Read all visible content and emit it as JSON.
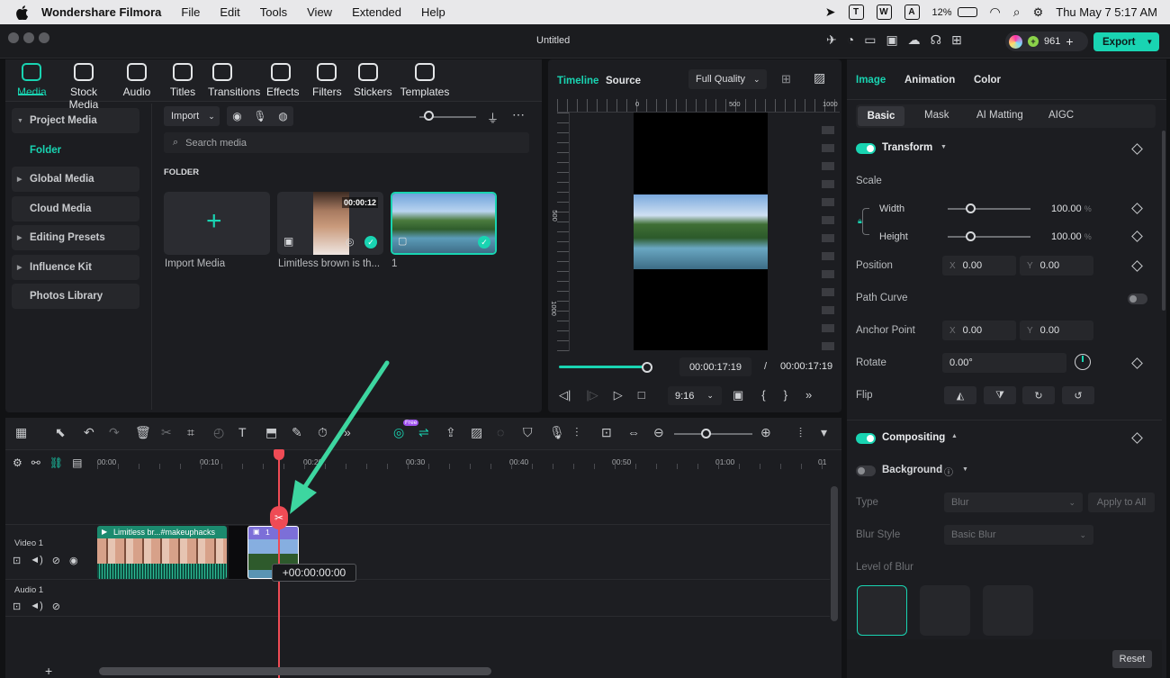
{
  "menubar": {
    "app": "Wondershare Filmora",
    "items": [
      "File",
      "Edit",
      "Tools",
      "View",
      "Extended",
      "Help"
    ],
    "battery": "12%",
    "datetime": "Thu May 7  5:17 AM"
  },
  "window": {
    "title": "Untitled",
    "credits": "961",
    "export_label": "Export"
  },
  "topnav": [
    {
      "label": "Media",
      "icon": "media-icon"
    },
    {
      "label": "Stock Media",
      "icon": "stock-media-icon"
    },
    {
      "label": "Audio",
      "icon": "audio-icon"
    },
    {
      "label": "Titles",
      "icon": "titles-icon"
    },
    {
      "label": "Transitions",
      "icon": "transitions-icon"
    },
    {
      "label": "Effects",
      "icon": "effects-icon"
    },
    {
      "label": "Filters",
      "icon": "filters-icon"
    },
    {
      "label": "Stickers",
      "icon": "stickers-icon"
    },
    {
      "label": "Templates",
      "icon": "templates-icon"
    }
  ],
  "sidebar": {
    "project_media": "Project Media",
    "folder": "Folder",
    "items": [
      "Global Media",
      "Cloud Media",
      "Editing Presets",
      "Influence Kit",
      "Photos Library"
    ]
  },
  "media": {
    "import_label": "Import",
    "search_placeholder": "Search media",
    "section": "FOLDER",
    "import_media": "Import Media",
    "clip_caption": "Limitless brown is th...",
    "clip_duration": "00:00:12",
    "image_caption": "1"
  },
  "preview": {
    "tab_timeline": "Timeline",
    "tab_source": "Source",
    "quality": "Full Quality",
    "ruler": [
      "0",
      "500",
      "1000"
    ],
    "vruler": [
      "500",
      "1000"
    ],
    "current_time": "00:00:17:19",
    "sep": "/",
    "total_time": "00:00:17:19",
    "ratio": "9:16",
    "progress": 1.0
  },
  "timeline": {
    "ticks": [
      "00:00",
      "00:10",
      "00:20",
      "00:30",
      "00:40",
      "00:50",
      "01:00",
      "01"
    ],
    "ai_badge": "Free",
    "video_track": "Video 1",
    "audio_track": "Audio 1",
    "clip1_label": "Limitless br...#makeuphacks",
    "clip2_label": "1",
    "offset_tooltip": "+00:00:00:00"
  },
  "props": {
    "tabs": [
      "Image",
      "Animation",
      "Color"
    ],
    "subtabs": [
      "Basic",
      "Mask",
      "AI Matting",
      "AIGC"
    ],
    "transform": "Transform",
    "scale": "Scale",
    "width": "Width",
    "width_val": "100.00",
    "height": "Height",
    "height_val": "100.00",
    "unit": "%",
    "position": "Position",
    "pos_x": "0.00",
    "pos_y": "0.00",
    "path_curve": "Path Curve",
    "anchor_point": "Anchor Point",
    "anchor_x": "0.00",
    "anchor_y": "0.00",
    "rotate": "Rotate",
    "rotate_val": "0.00°",
    "flip": "Flip",
    "compositing": "Compositing",
    "background": "Background",
    "type": "Type",
    "type_val": "Blur",
    "apply_all": "Apply to All",
    "blur_style": "Blur Style",
    "blur_style_val": "Basic Blur",
    "level_of_blur": "Level of Blur",
    "reset": "Reset",
    "x": "X",
    "y": "Y"
  },
  "colors": {
    "accent": "#19d4b2",
    "playhead": "#ef4b55",
    "bg": "#111214",
    "panel": "#1c1d21",
    "arrow": "#3dd6a0"
  }
}
